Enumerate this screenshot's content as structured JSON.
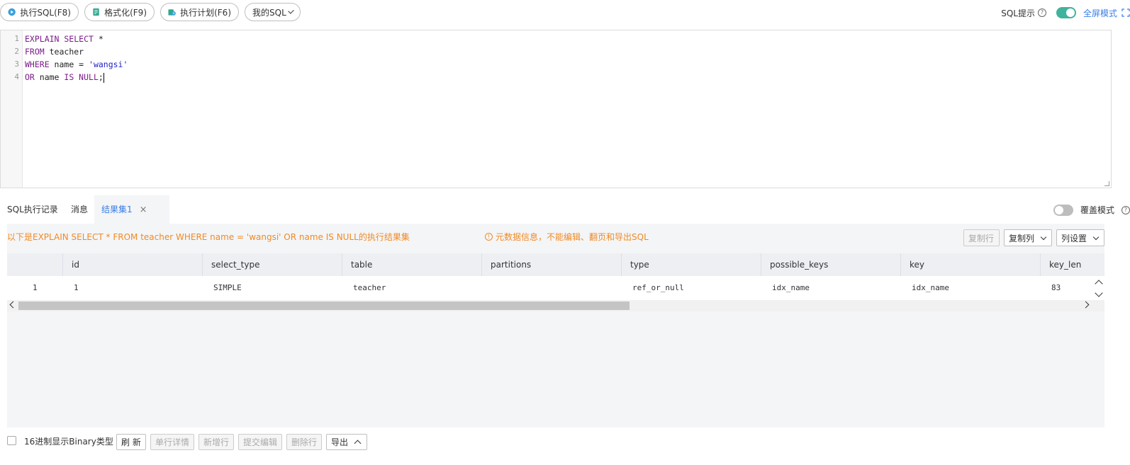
{
  "toolbar": {
    "run_sql": "执行SQL(F8)",
    "format": "格式化(F9)",
    "exec_plan": "执行计划(F6)",
    "my_sql": "我的SQL",
    "sql_hint": "SQL提示",
    "sql_hint_enabled": true,
    "fullscreen": "全屏模式"
  },
  "editor": {
    "lines": [
      {
        "num": "1",
        "tokens": [
          {
            "t": "EXPLAIN SELECT",
            "c": "kw"
          },
          {
            "t": " *",
            "c": ""
          }
        ]
      },
      {
        "num": "2",
        "tokens": [
          {
            "t": "FROM",
            "c": "kw"
          },
          {
            "t": " teacher",
            "c": ""
          }
        ]
      },
      {
        "num": "3",
        "tokens": [
          {
            "t": "WHERE",
            "c": "kw"
          },
          {
            "t": " name = ",
            "c": ""
          },
          {
            "t": "'wangsi'",
            "c": "str"
          }
        ]
      },
      {
        "num": "4",
        "tokens": [
          {
            "t": "OR",
            "c": "kw"
          },
          {
            "t": " name ",
            "c": ""
          },
          {
            "t": "IS NULL",
            "c": "kw"
          },
          {
            "t": ";",
            "c": ""
          }
        ]
      }
    ]
  },
  "tabs": {
    "history": "SQL执行记录",
    "messages": "消息",
    "result": "结果集1",
    "close": "×"
  },
  "overlay_mode": {
    "label": "覆盖模式",
    "enabled": false
  },
  "result": {
    "info": "以下是EXPLAIN SELECT * FROM teacher WHERE name = 'wangsi' OR name IS NULL的执行结果集",
    "warning": "元数据信息，不能编辑、翻页和导出SQL",
    "copy_row": "复制行",
    "copy_col": "复制列",
    "col_settings": "列设置"
  },
  "grid": {
    "columns": [
      "id",
      "select_type",
      "table",
      "partitions",
      "type",
      "possible_keys",
      "key",
      "key_len"
    ],
    "rows": [
      {
        "index": "1",
        "cells": [
          "1",
          "SIMPLE",
          "teacher",
          "",
          "ref_or_null",
          "idx_name",
          "idx_name",
          "83"
        ]
      }
    ]
  },
  "footer": {
    "hex_label": "16进制显示Binary类型",
    "refresh": "刷 新",
    "row_detail": "单行详情",
    "add_row": "新增行",
    "submit_edit": "提交编辑",
    "delete_row": "删除行",
    "export": "导出"
  },
  "colors": {
    "accent": "#3a7ee8",
    "toggle_on": "#3fb39b",
    "warning": "#f08a24"
  }
}
